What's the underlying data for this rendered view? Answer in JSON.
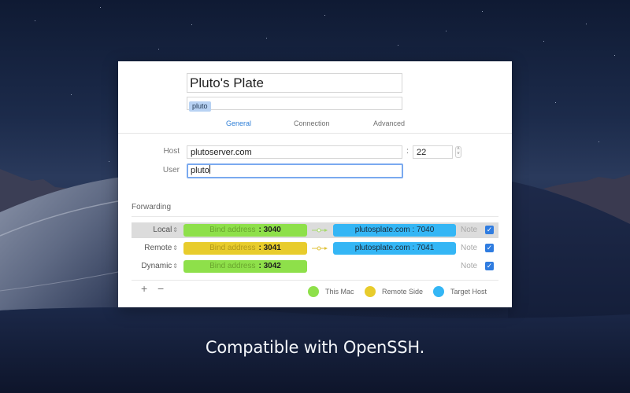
{
  "background": {
    "description": "macOS Mojave night desert wallpaper"
  },
  "window": {
    "name_field": "Pluto's Plate",
    "tags": [
      "pluto"
    ],
    "tabs": [
      {
        "label": "General",
        "active": true
      },
      {
        "label": "Connection",
        "active": false
      },
      {
        "label": "Advanced",
        "active": false
      }
    ],
    "host": {
      "label": "Host",
      "value": "plutoserver.com",
      "port_separator": ":",
      "port": "22"
    },
    "user": {
      "label": "User",
      "value": "pluto"
    },
    "forwarding": {
      "title": "Forwarding",
      "rows": [
        {
          "type": "Local",
          "bind_placeholder": "Bind address",
          "bind_port": ": 3040",
          "target": "plutosplate.com  : 7040",
          "note": "Note",
          "enabled": true,
          "selected": true
        },
        {
          "type": "Remote",
          "bind_placeholder": "Bind address",
          "bind_port": ": 3041",
          "target": "plutosplate.com  : 7041",
          "note": "Note",
          "enabled": true,
          "selected": false
        },
        {
          "type": "Dynamic",
          "bind_placeholder": "Bind address",
          "bind_port": ": 3042",
          "target": "",
          "note": "Note",
          "enabled": true,
          "selected": false
        }
      ],
      "add_label": "+",
      "remove_label": "−",
      "legend": [
        {
          "label": "This Mac",
          "color": "#8ee04a"
        },
        {
          "label": "Remote Side",
          "color": "#e8cc2c"
        },
        {
          "label": "Target Host",
          "color": "#34b6f5"
        }
      ]
    }
  },
  "colors": {
    "local": "#8ee04a",
    "remote": "#e8cc2c",
    "target": "#34b6f5",
    "accent": "#2f7fd7"
  },
  "caption": "Compatible with OpenSSH."
}
